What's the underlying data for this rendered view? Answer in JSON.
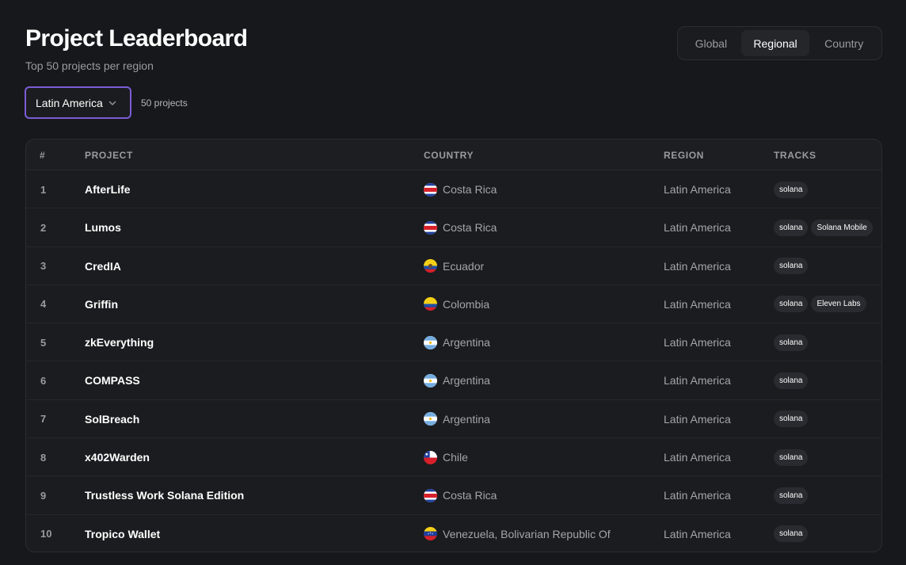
{
  "header": {
    "title": "Project Leaderboard",
    "subtitle": "Top 50 projects per region"
  },
  "scope_tabs": {
    "items": [
      "Global",
      "Regional",
      "Country"
    ],
    "active": "Regional"
  },
  "filter": {
    "region_value": "Latin America",
    "count_label": "50 projects"
  },
  "table": {
    "columns": [
      "#",
      "PROJECT",
      "COUNTRY",
      "REGION",
      "TRACKS"
    ],
    "rows": [
      {
        "rank": "1",
        "project": "AfterLife",
        "country": "Costa Rica",
        "flag": "costa-rica",
        "region": "Latin America",
        "tracks": [
          "solana"
        ]
      },
      {
        "rank": "2",
        "project": "Lumos",
        "country": "Costa Rica",
        "flag": "costa-rica",
        "region": "Latin America",
        "tracks": [
          "solana",
          "Solana Mobile"
        ]
      },
      {
        "rank": "3",
        "project": "CredIA",
        "country": "Ecuador",
        "flag": "ecuador",
        "region": "Latin America",
        "tracks": [
          "solana"
        ]
      },
      {
        "rank": "4",
        "project": "Griffin",
        "country": "Colombia",
        "flag": "colombia",
        "region": "Latin America",
        "tracks": [
          "solana",
          "Eleven Labs"
        ]
      },
      {
        "rank": "5",
        "project": "zkEverything",
        "country": "Argentina",
        "flag": "argentina",
        "region": "Latin America",
        "tracks": [
          "solana"
        ]
      },
      {
        "rank": "6",
        "project": "COMPASS",
        "country": "Argentina",
        "flag": "argentina",
        "region": "Latin America",
        "tracks": [
          "solana"
        ]
      },
      {
        "rank": "7",
        "project": "SolBreach",
        "country": "Argentina",
        "flag": "argentina",
        "region": "Latin America",
        "tracks": [
          "solana"
        ]
      },
      {
        "rank": "8",
        "project": "x402Warden",
        "country": "Chile",
        "flag": "chile",
        "region": "Latin America",
        "tracks": [
          "solana"
        ]
      },
      {
        "rank": "9",
        "project": "Trustless Work Solana Edition",
        "country": "Costa Rica",
        "flag": "costa-rica",
        "region": "Latin America",
        "tracks": [
          "solana"
        ]
      },
      {
        "rank": "10",
        "project": "Tropico Wallet",
        "country": "Venezuela, Bolivarian Republic Of",
        "flag": "venezuela",
        "region": "Latin America",
        "tracks": [
          "solana"
        ]
      }
    ]
  },
  "colors": {
    "background": "#17181b",
    "accent_border": "#7b5cd6",
    "tag_bg": "#2a2b30"
  }
}
